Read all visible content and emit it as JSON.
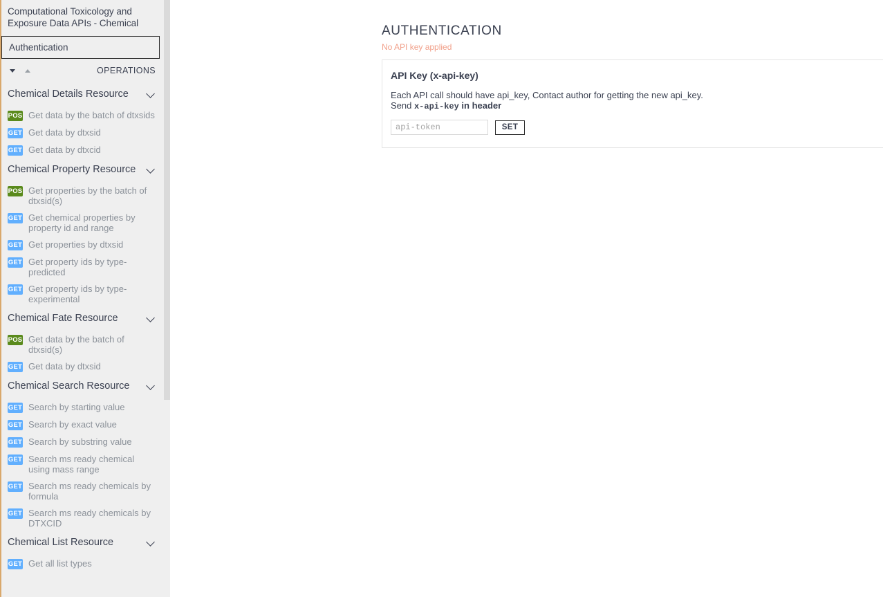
{
  "sidebar": {
    "api_title": "Computational Toxicology and Exposure Data APIs - Chemical",
    "auth_tab_label": "Authentication",
    "operations_label": "OPERATIONS",
    "sort_desc_icon": "triangle-down-icon",
    "sort_asc_icon": "triangle-up-icon",
    "sections": [
      {
        "title": "Chemical Details Resource",
        "chevron_icon": "chevron-down-icon",
        "operations": [
          {
            "method": "POS",
            "label": "Get data by the batch of dtxsids"
          },
          {
            "method": "GET",
            "label": "Get data by dtxsid"
          },
          {
            "method": "GET",
            "label": "Get data by dtxcid"
          }
        ]
      },
      {
        "title": "Chemical Property Resource",
        "chevron_icon": "chevron-down-icon",
        "operations": [
          {
            "method": "POS",
            "label": "Get properties by the batch of dtxsid(s)"
          },
          {
            "method": "GET",
            "label": "Get chemical properties by property id and range"
          },
          {
            "method": "GET",
            "label": "Get properties by dtxsid"
          },
          {
            "method": "GET",
            "label": "Get property ids by type-predicted"
          },
          {
            "method": "GET",
            "label": "Get property ids by type-experimental"
          }
        ]
      },
      {
        "title": "Chemical Fate Resource",
        "chevron_icon": "chevron-down-icon",
        "operations": [
          {
            "method": "POS",
            "label": "Get data by the batch of dtxsid(s)"
          },
          {
            "method": "GET",
            "label": "Get data by dtxsid"
          }
        ]
      },
      {
        "title": "Chemical Search Resource",
        "chevron_icon": "chevron-down-icon",
        "operations": [
          {
            "method": "GET",
            "label": "Search by starting value"
          },
          {
            "method": "GET",
            "label": "Search by exact value"
          },
          {
            "method": "GET",
            "label": "Search by substring value"
          },
          {
            "method": "GET",
            "label": "Search ms ready chemical using mass range"
          },
          {
            "method": "GET",
            "label": "Search ms ready chemicals by formula"
          },
          {
            "method": "GET",
            "label": "Search ms ready chemicals by DTXCID"
          }
        ]
      },
      {
        "title": "Chemical List Resource",
        "chevron_icon": "chevron-down-icon",
        "operations": [
          {
            "method": "GET",
            "label": "Get all list types"
          }
        ]
      }
    ]
  },
  "main": {
    "page_title": "AUTHENTICATION",
    "status_text": "No API key applied",
    "panel": {
      "heading": "API Key (x-api-key)",
      "description_line1": "Each API call should have api_key, Contact author for getting the new api_key.",
      "description_line2_prefix": "Send ",
      "description_line2_code": "x-api-key",
      "description_line2_suffix": " in header",
      "input_placeholder": "api-token",
      "input_value": "",
      "set_button_label": "SET"
    }
  },
  "colors": {
    "method_get": "#61affe",
    "method_post": "#5a8a1c",
    "status_warning": "#f1a08a",
    "text_dark": "#3b4151",
    "text_muted": "#8b9199",
    "sidebar_bg": "#efefef",
    "accent_edge": "#d9a86c"
  }
}
